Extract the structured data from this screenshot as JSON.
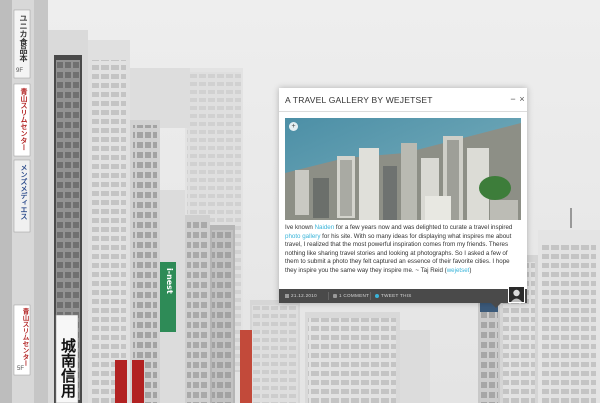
{
  "popup": {
    "title": "A TRAVEL GALLERY BY WEJETSET",
    "minimize_icon": "−",
    "close_icon": "×",
    "expand_icon": "+",
    "body": {
      "t1": "Ive known ",
      "link1": "Naiden",
      "t2": " for a few years now and was delighted to curate a travel inspired ",
      "link2": "photo gallery",
      "t3": " for his site. With so many ideas for displaying what inspires me about travel, I realized that the most powerful inspiration comes from my friends. Theres nothing like sharing travel stories and looking at photographs. So I asked a few of them to submit a photo they felt captured an essence of their favorite cities. I hope they inspire you the same way they inspire me. ~ Taj Reid (",
      "link3": "wejetset",
      "t4": ")"
    },
    "footer": {
      "date": "21.12.2010",
      "comments": "1 COMMENT",
      "tweet": "TWEET THIS"
    }
  },
  "signs": {
    "vertical_left_1": "ユニカ食品本",
    "vertical_left_1_tag": "9F",
    "vertical_left_2": "青山スリムセンター",
    "vertical_left_3": "メンズメディエス",
    "vertical_left_4": "青山スリムセンター",
    "vertical_left_4_tag": "5F",
    "vertical_kanji": "城南信用",
    "green_sign": "i-nest"
  },
  "colors": {
    "link": "#3ab4d9",
    "footer_bg": "#4a4a4a",
    "sign_green": "#2e8b57",
    "sign_red": "#b22222"
  }
}
